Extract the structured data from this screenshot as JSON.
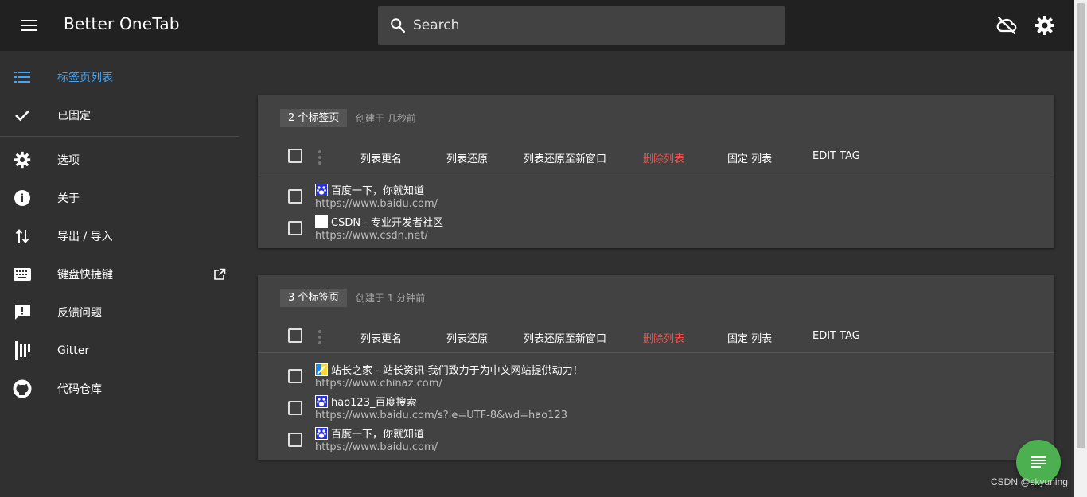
{
  "header": {
    "title": "Better OneTab",
    "search_placeholder": "Search",
    "icons": [
      "menu-icon",
      "search-icon",
      "cloud-off-icon",
      "settings-icon"
    ]
  },
  "sidebar": {
    "items": [
      {
        "label": "标签页列表",
        "icon": "list-icon",
        "active": true
      },
      {
        "label": "已固定",
        "icon": "check-icon"
      },
      {
        "label": "选项",
        "icon": "gear-icon"
      },
      {
        "label": "关于",
        "icon": "info-icon"
      },
      {
        "label": "导出 / 导入",
        "icon": "swap-vertical-icon"
      },
      {
        "label": "键盘快捷键",
        "icon": "keyboard-icon",
        "external": "open-in-new-icon"
      },
      {
        "label": "反馈问题",
        "icon": "feedback-icon"
      },
      {
        "label": "Gitter",
        "icon": "gitter-icon"
      },
      {
        "label": "代码仓库",
        "icon": "github-icon"
      }
    ]
  },
  "actions": {
    "rename": "列表更名",
    "restore": "列表还原",
    "restore_new_window": "列表还原至新窗口",
    "delete": "删除列表",
    "pin": "固定 列表",
    "edit_tag": "EDIT TAG"
  },
  "lists": [
    {
      "count_label": "2 个标签页",
      "created": "创建于 几秒前",
      "tabs": [
        {
          "title": "百度一下，你就知道",
          "url": "https://www.baidu.com/",
          "favicon": "baidu-icon"
        },
        {
          "title": "CSDN - 专业开发者社区",
          "url": "https://www.csdn.net/",
          "favicon": "csdn-icon"
        }
      ]
    },
    {
      "count_label": "3 个标签页",
      "created": "创建于 1 分钟前",
      "tabs": [
        {
          "title": "站长之家 - 站长资讯-我们致力于为中文网站提供动力！",
          "url": "https://www.chinaz.com/",
          "favicon": "chinaz-icon"
        },
        {
          "title": "hao123_百度搜索",
          "url": "https://www.baidu.com/s?ie=UTF-8&wd=hao123",
          "favicon": "baidu-icon"
        },
        {
          "title": "百度一下，你就知道",
          "url": "https://www.baidu.com/",
          "favicon": "baidu-icon"
        }
      ]
    }
  ],
  "watermark": "CSDN @skyuning",
  "colors": {
    "topbar": "#212121",
    "background": "#303030",
    "card": "#424242",
    "active_nav": "#42a5f5",
    "danger": "#ef5350",
    "fab": "#4caf50"
  }
}
